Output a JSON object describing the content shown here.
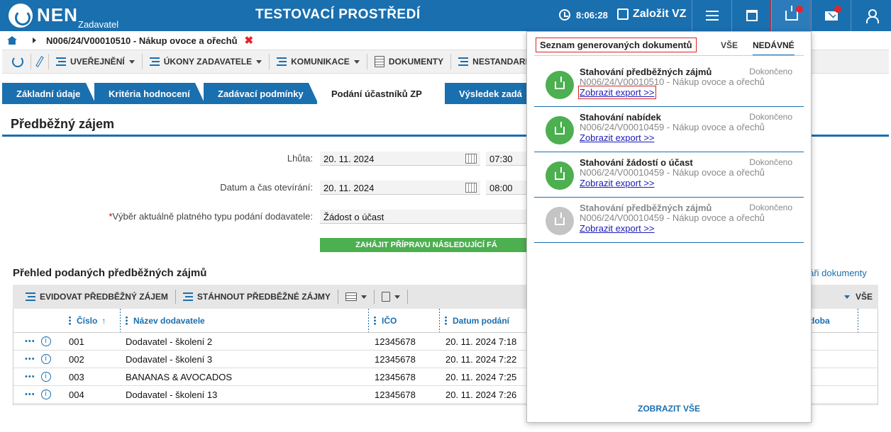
{
  "header": {
    "logo_text": "NEN",
    "logo_sub": "Zadavatel",
    "env_title": "TESTOVACÍ PROSTŘEDÍ",
    "time": "8:06:28",
    "create_label": "Založit VZ",
    "icons": [
      "clock-icon",
      "pencil-icon",
      "menu-icon",
      "calendar-icon",
      "tray-icon",
      "mail-icon",
      "user-icon"
    ],
    "accent_color": "#1a6faf"
  },
  "breadcrumb": {
    "item": "N006/24/V00010510 - Nákup ovoce a ořechů"
  },
  "toolbar": {
    "uverejneni": "UVEŘEJNĚNÍ",
    "ukony": "ÚKONY ZADAVATELE",
    "komunikace": "KOMUNIKACE",
    "dokumenty": "DOKUMENTY",
    "nestandardni": "NESTANDARDNÍ"
  },
  "tabs": [
    "Základní údaje",
    "Kritéria hodnocení",
    "Zadávací podmínky",
    "Podání účastníků ZP",
    "Výsledek zadá"
  ],
  "form": {
    "section_title": "Předběžný zájem",
    "lhuta_label": "Lhůta:",
    "lhuta_date": "20. 11. 2024",
    "lhuta_time": "07:30",
    "otevirani_label": "Datum a čas otevírání:",
    "otevirani_date": "20. 11. 2024",
    "otevirani_time": "08:00",
    "typ_label": "Výběr aktuálně platného typu podání dodavatele:",
    "typ_value": "Žádost o účast",
    "green_button": "ZAHÁJIT PŘÍPRAVU NÁSLEDUJÍCÍ FÁ"
  },
  "list": {
    "title": "Přehled podaných předběžných zájmů",
    "link": "uláři dokumenty",
    "tool_evidovat": "EVIDOVAT PŘEDBĚŽNÝ ZÁJEM",
    "tool_stahnout": "STÁHNOUT PŘEDBĚŽNÉ ZÁJMY",
    "tool_vse": "VŠE",
    "columns": {
      "cislo": "Číslo",
      "nazev": "Název dodavatele",
      "ico": "IČO",
      "datum": "Datum podání",
      "doba": "doba"
    },
    "rows": [
      {
        "more": "•••",
        "cislo": "001",
        "nazev": "Dodavatel - školení 2",
        "ico": "12345678",
        "datum": "20. 11. 2024 7:18"
      },
      {
        "more": "•••",
        "cislo": "002",
        "nazev": "Dodavatel - školení 3",
        "ico": "12345678",
        "datum": "20. 11. 2024 7:22"
      },
      {
        "more": "•••",
        "cislo": "003",
        "nazev": "BANANAS & AVOCADOS",
        "ico": "12345678",
        "datum": "20. 11. 2024 7:25"
      },
      {
        "more": "•••",
        "cislo": "004",
        "nazev": "Dodavatel - školení 13",
        "ico": "12345678",
        "datum": "20. 11. 2024 7:26"
      }
    ]
  },
  "panel": {
    "title": "Seznam generovaných dokumentů",
    "tab_all": "VŠE",
    "tab_recent": "NEDÁVNÉ",
    "show_all": "ZOBRAZIT VŠE",
    "items": [
      {
        "title": "Stahování předběžných zájmů",
        "status": "Dokončeno",
        "sub": "N006/24/V00010510 - Nákup ovoce a ořechů",
        "link": "Zobrazit export >>"
      },
      {
        "title": "Stahování nabídek",
        "status": "Dokončeno",
        "sub": "N006/24/V00010459 - Nákup ovoce a ořechů",
        "link": "Zobrazit export >>"
      },
      {
        "title": "Stahování žádostí o účast",
        "status": "Dokončeno",
        "sub": "N006/24/V00010459 - Nákup ovoce a ořechů",
        "link": "Zobrazit export >>"
      },
      {
        "title": "Stahování předběžných zájmů",
        "status": "Dokončeno",
        "sub": "N006/24/V00010459 - Nákup ovoce a ořechů",
        "link": "Zobrazit export >>"
      }
    ]
  }
}
